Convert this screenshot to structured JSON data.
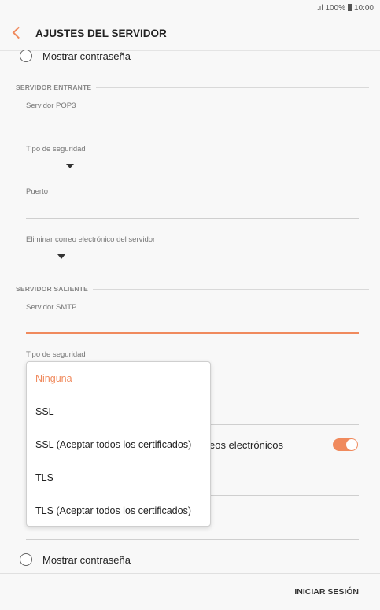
{
  "status": {
    "signal": ".ıl",
    "battery": "100%",
    "time": "10:00"
  },
  "header": {
    "title": "AJUSTES DEL SERVIDOR"
  },
  "top_radio": {
    "label": "Mostrar contraseña"
  },
  "incoming": {
    "section_title": "SERVIDOR ENTRANTE",
    "pop3_label": "Servidor POP3",
    "pop3_value": "",
    "security_label": "Tipo de seguridad",
    "port_label": "Puerto",
    "port_value": "",
    "delete_label": "Eliminar correo electrónico del servidor"
  },
  "outgoing": {
    "section_title": "SERVIDOR SALIENTE",
    "smtp_label": "Servidor SMTP",
    "smtp_value": "",
    "security_label": "Tipo de seguridad",
    "partial_text": "eos electrónicos"
  },
  "dropdown": {
    "options": [
      {
        "label": "Ninguna",
        "selected": true
      },
      {
        "label": "SSL",
        "selected": false
      },
      {
        "label": "SSL (Aceptar todos los certificados)",
        "selected": false
      },
      {
        "label": "TLS",
        "selected": false
      },
      {
        "label": "TLS (Aceptar todos los certificados)",
        "selected": false
      }
    ]
  },
  "bottom_radio": {
    "label": "Mostrar contraseña"
  },
  "footer": {
    "login_label": "INICIAR SESIÓN"
  },
  "colors": {
    "accent": "#f08a5d",
    "background": "#f8f8f8"
  }
}
